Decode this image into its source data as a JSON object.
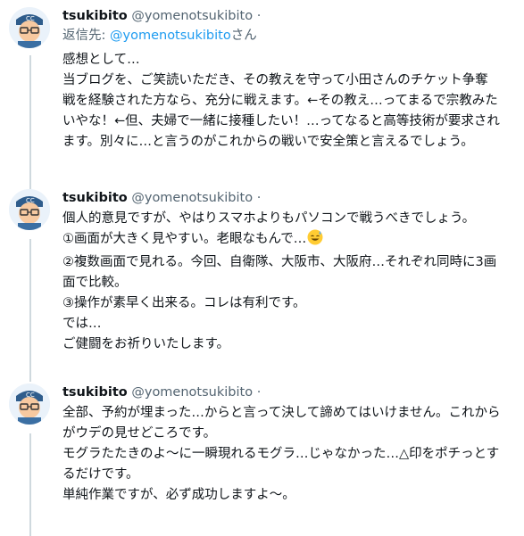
{
  "tweets": [
    {
      "author": {
        "name": "tsukibito",
        "handle": "@yomenotsukibito",
        "separator": "·"
      },
      "reply": {
        "prefix": "返信先: ",
        "target": "@yomenotsukibito",
        "suffix": "さん"
      },
      "lines": [
        "感想として…",
        "当ブログを、ご笑読いただき、その教えを守って小田さんのチケット争奪",
        "戦を経験された方なら、充分に戦えます。←その教え…ってまるで宗教みた",
        "いやな！←但、夫婦で一緒に接種したい！…ってなると高等技術が要求され",
        "ます。別々に…と言うのがこれからの戦いで安全策と言えるでしょう。"
      ]
    },
    {
      "author": {
        "name": "tsukibito",
        "handle": "@yomenotsukibito",
        "separator": "·"
      },
      "lines": [
        "個人的意見ですが、やはりスマホよりもパソコンで戦うべきでしょう。",
        "①画面が大きく見やすい。老眼なもんで…",
        "②複数画面で見れる。今回、自衛隊、大阪市、大阪府…それぞれ同時に3画",
        "面で比較。",
        "③操作が素早く出来る。コレは有利です。",
        "では…",
        "ご健闘をお祈りいたします。"
      ],
      "emoji_after_line": 1,
      "emoji_name": "grinning-sweat-emoji-icon"
    },
    {
      "author": {
        "name": "tsukibito",
        "handle": "@yomenotsukibito",
        "separator": "·"
      },
      "lines": [
        "全部、予約が埋まった…からと言って決して諦めてはいけません。これから",
        "がウデの見せどころです。",
        "モグラたたきのよ〜に一瞬現れるモグラ…じゃなかった…△印をポチっとす",
        "るだけです。",
        "単純作業ですが、必ず成功しますよ〜。"
      ]
    }
  ]
}
